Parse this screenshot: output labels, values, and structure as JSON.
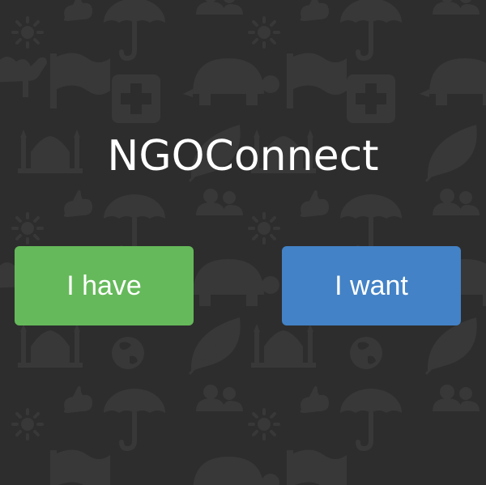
{
  "app": {
    "title": "NGOConnect"
  },
  "actions": {
    "have_label": "I have",
    "want_label": "I want"
  },
  "colors": {
    "background": "#2d2d2d",
    "pattern": "#383838",
    "have_button": "#65b95a",
    "want_button": "#4382c6",
    "text": "#ffffff"
  },
  "background_icons": [
    "sun-icon",
    "rabbit-icon",
    "umbrella-icon",
    "people-icon",
    "turtle-icon",
    "flag-icon",
    "medical-cross-icon",
    "leaf-icon",
    "mosque-icon",
    "globe-icon",
    "camel-icon"
  ]
}
